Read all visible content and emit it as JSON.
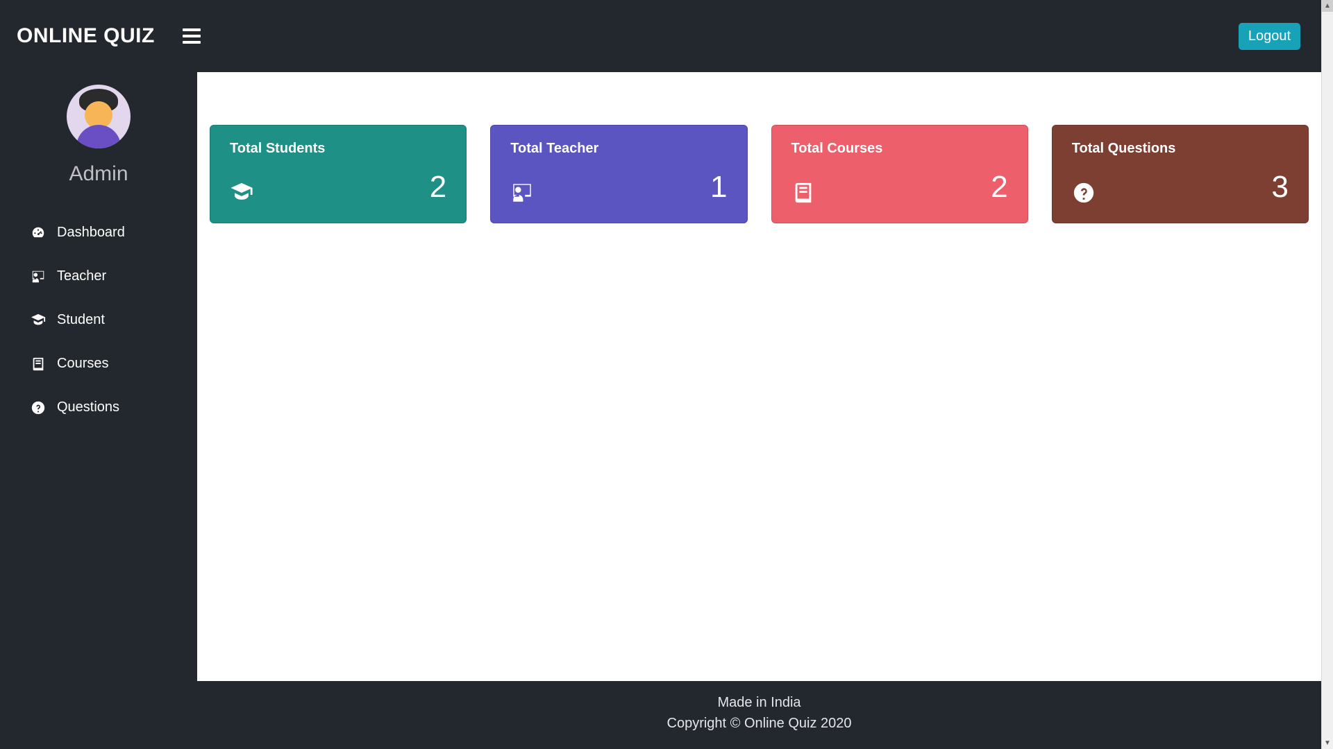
{
  "header": {
    "brand": "ONLINE QUIZ",
    "logout_label": "Logout"
  },
  "sidebar": {
    "user_name": "Admin",
    "items": [
      {
        "label": "Dashboard",
        "icon": "gauge-icon"
      },
      {
        "label": "Teacher",
        "icon": "chalkboard-teacher-icon"
      },
      {
        "label": "Student",
        "icon": "graduate-icon"
      },
      {
        "label": "Courses",
        "icon": "book-icon"
      },
      {
        "label": "Questions",
        "icon": "question-circle-icon"
      }
    ]
  },
  "cards": [
    {
      "title": "Total Students",
      "value": "2",
      "color": "c-teal",
      "icon": "graduate-icon"
    },
    {
      "title": "Total Teacher",
      "value": "1",
      "color": "c-indigo",
      "icon": "chalkboard-teacher-icon"
    },
    {
      "title": "Total Courses",
      "value": "2",
      "color": "c-rose",
      "icon": "book-icon"
    },
    {
      "title": "Total Questions",
      "value": "3",
      "color": "c-brown",
      "icon": "question-circle-icon"
    }
  ],
  "footer": {
    "line1": "Made in India",
    "line2": "Copyright © Online Quiz 2020"
  },
  "colors": {
    "header_bg": "#23272e",
    "accent": "#17a2b8"
  }
}
